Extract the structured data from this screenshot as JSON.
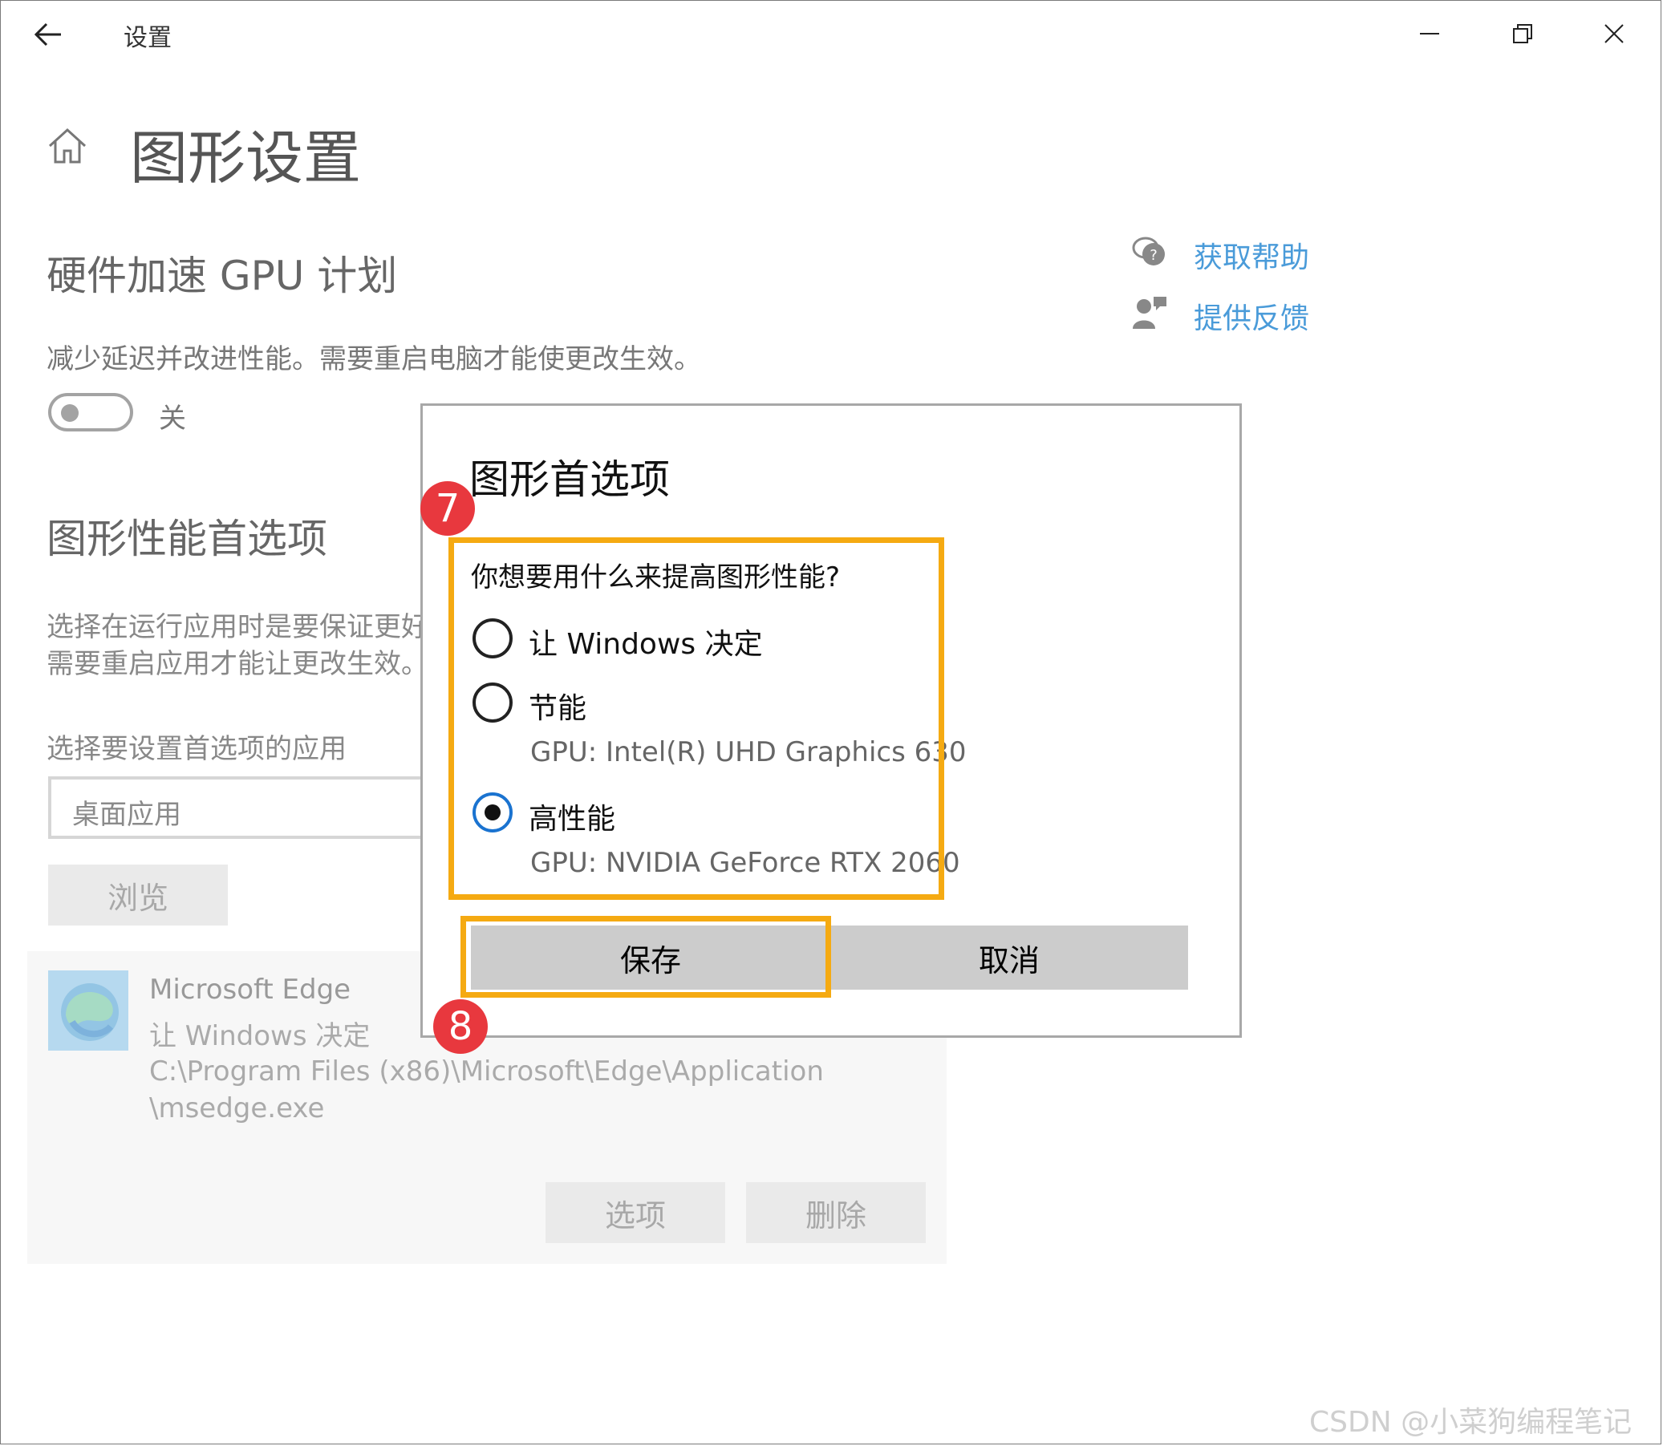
{
  "window": {
    "title": "设置",
    "controls": [
      "minimize",
      "restore",
      "close"
    ]
  },
  "page": {
    "title": "图形设置"
  },
  "gpu_scheduling": {
    "heading": "硬件加速 GPU 计划",
    "description": "减少延迟并改进性能。需要重启电脑才能使更改生效。",
    "toggle_label": "关",
    "toggle_on": false
  },
  "preferences": {
    "heading": "图形性能首选项",
    "description_line1": "选择在运行应用时是要保证更好",
    "description_line2": "需要重启应用才能让更改生效。",
    "app_select_label": "选择要设置首选项的应用",
    "app_type_value": "桌面应用",
    "browse_label": "浏览"
  },
  "app_entry": {
    "name": "Microsoft Edge",
    "setting": "让 Windows 决定",
    "path_line1": "C:\\Program Files (x86)\\Microsoft\\Edge\\Application",
    "path_line2": "\\msedge.exe",
    "options_label": "选项",
    "delete_label": "删除"
  },
  "links": {
    "help": "获取帮助",
    "feedback": "提供反馈"
  },
  "dialog": {
    "title": "图形首选项",
    "question": "你想要用什么来提高图形性能?",
    "options": [
      {
        "label": "让 Windows 决定",
        "sub": "",
        "selected": false
      },
      {
        "label": "节能",
        "sub": "GPU: Intel(R) UHD Graphics 630",
        "selected": false
      },
      {
        "label": "高性能",
        "sub": "GPU: NVIDIA GeForce RTX 2060",
        "selected": true
      }
    ],
    "save_label": "保存",
    "cancel_label": "取消"
  },
  "annotations": {
    "step1": "7",
    "step2": "8",
    "highlight_color": "#f5aa12",
    "badge_color": "#e8383e"
  },
  "watermark": "CSDN @小菜狗编程笔记"
}
